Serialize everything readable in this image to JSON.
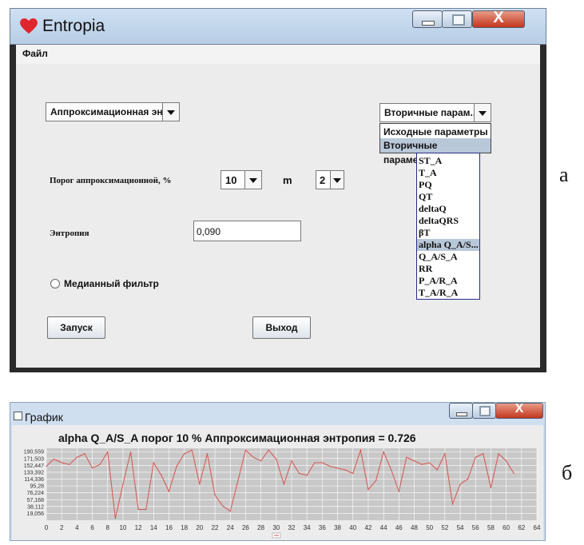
{
  "windowA": {
    "title": "Entropia",
    "close_glyph": "X",
    "menu": {
      "file": "Файл"
    },
    "method_combo": "Аппроксимационная энт...",
    "threshold_label": "Порог аппроксимационной, %",
    "threshold_value": "10",
    "m_label": "m",
    "m_value": "2",
    "entropy_label": "Энтропия",
    "entropy_value": "0,090",
    "median_filter_label": "Медианный фильтр",
    "start_button": "Запуск",
    "exit_button": "Выход",
    "param_combo": "Вторичные парам...",
    "param_sets": [
      {
        "label": "Исходные параметры"
      },
      {
        "label": "Вторичные параметры"
      }
    ],
    "secondary_params": [
      {
        "label": "ST_A"
      },
      {
        "label": "T_A"
      },
      {
        "label": "PQ"
      },
      {
        "label": "QT"
      },
      {
        "label": "deltaQ"
      },
      {
        "label": "deltaQRS"
      },
      {
        "label": "βT"
      },
      {
        "label": "alpha Q_A/S..."
      },
      {
        "label": "Q_A/S_A"
      },
      {
        "label": "RR"
      },
      {
        "label": "P_A/R_A"
      },
      {
        "label": "T_A/R_A"
      }
    ],
    "selected_param_index": 7,
    "selected_set_index": 1,
    "side_label": "а"
  },
  "windowB": {
    "title": "График",
    "close_glyph": "X",
    "chart_title": "alpha Q_A/S_A порог 10 % Аппроксимационная энтропия =  0.726",
    "side_label": "б"
  },
  "colors": {
    "line": "#d9534f",
    "plot_bg": "#c8c8c8",
    "grid": "#ffffff",
    "selection": "#b9c8d9"
  },
  "chart_data": {
    "type": "line",
    "title": "alpha Q_A/S_A порог 10 % Аппроксимационная энтропия =  0.726",
    "y_ticks": [
      "190,559",
      "171,503",
      "152,447",
      "133,392",
      "114,336",
      "95,28",
      "76,224",
      "57,168",
      "38,112",
      "19,056"
    ],
    "y_tick_values": [
      190.559,
      171.503,
      152.447,
      133.392,
      114.336,
      95.28,
      76.224,
      57.168,
      38.112,
      19.056
    ],
    "x_ticks": [
      "0",
      "2",
      "4",
      "6",
      "8",
      "10",
      "12",
      "14",
      "16",
      "18",
      "20",
      "22",
      "24",
      "26",
      "28",
      "30",
      "32",
      "34",
      "36",
      "38",
      "40",
      "42",
      "44",
      "46",
      "48",
      "50",
      "52",
      "54",
      "56",
      "58",
      "60",
      "62",
      "64"
    ],
    "xlim": [
      0,
      64
    ],
    "ylim": [
      0,
      200
    ],
    "grid": true,
    "series": [
      {
        "x": [
          0,
          1,
          2,
          3,
          4,
          5,
          6,
          7,
          8,
          9,
          10,
          11,
          12,
          13,
          14,
          15,
          16,
          17,
          18,
          19,
          20,
          21,
          22,
          23,
          24,
          25,
          26,
          27,
          28,
          29,
          30,
          31,
          32,
          33,
          34,
          35,
          36,
          37,
          38,
          39,
          40,
          41,
          42,
          43,
          44,
          45,
          46,
          47,
          48,
          49,
          50,
          51,
          52,
          53,
          54,
          55,
          56,
          57,
          58,
          59,
          60,
          61
        ],
        "values": [
          150,
          170,
          160,
          155,
          175,
          185,
          145,
          155,
          190,
          5,
          100,
          190,
          30,
          30,
          160,
          125,
          80,
          150,
          185,
          195,
          100,
          185,
          70,
          40,
          25,
          110,
          195,
          175,
          165,
          195,
          170,
          100,
          165,
          130,
          125,
          160,
          160,
          150,
          145,
          140,
          130,
          195,
          85,
          110,
          190,
          140,
          80,
          175,
          165,
          155,
          160,
          140,
          185,
          45,
          100,
          115,
          175,
          185,
          90,
          185,
          165,
          130
        ]
      }
    ]
  }
}
